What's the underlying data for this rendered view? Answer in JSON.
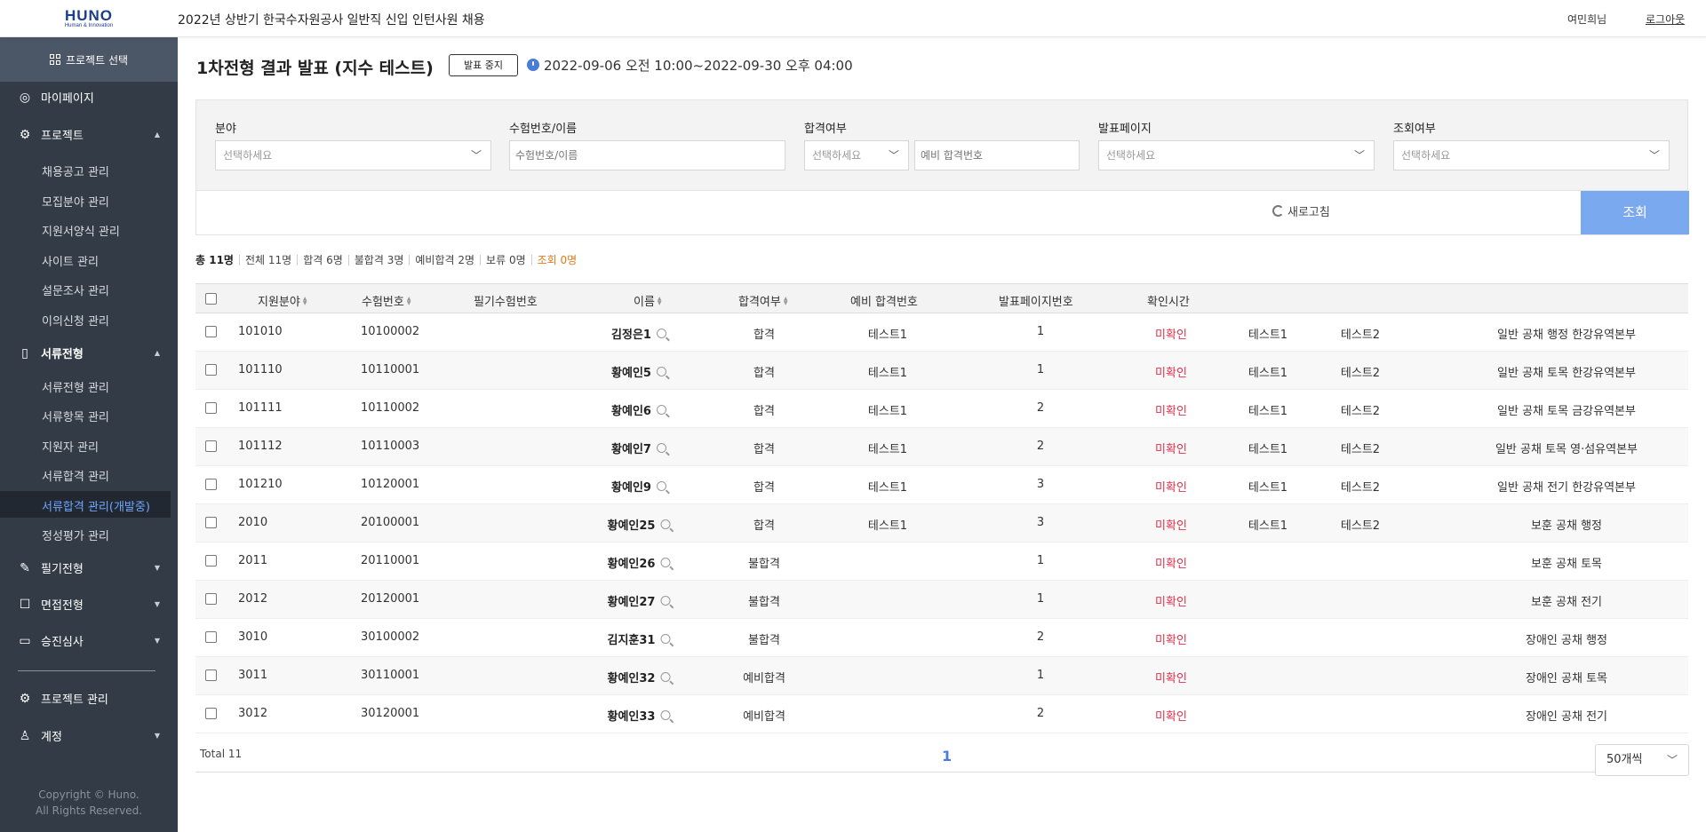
{
  "header": {
    "logo_main": "HUNO",
    "logo_sub": "Human & Innovation",
    "title": "2022년 상반기 한국수자원공사 일반직 신입 인턴사원 채용",
    "user": "여민희님",
    "logout": "로그아웃"
  },
  "sidebar": {
    "project_select": "프로젝트 선택",
    "mypage": "마이페이지",
    "project": "프로젝트",
    "project_items": [
      "채용공고 관리",
      "모집분야 관리",
      "지원서양식 관리",
      "사이트 관리",
      "설문조사 관리",
      "이의신청 관리"
    ],
    "document": "서류전형",
    "document_items": [
      "서류전형 관리",
      "서류항목 관리",
      "지원자 관리",
      "서류합격 관리",
      "서류합격 관리(개발중)",
      "정성평가 관리"
    ],
    "written": "필기전형",
    "interview": "면접전형",
    "promotion": "승진심사",
    "project_manage": "프로젝트 관리",
    "account": "계정",
    "copyright_1": "Copyright © Huno.",
    "copyright_2": "All Rights Reserved."
  },
  "page": {
    "title": "1차전형 결과 발표 (지수 테스트)",
    "status_button": "발표 중지",
    "period": "2022-09-06 오전 10:00~2022-09-30 오후 04:00"
  },
  "filters": {
    "field_label": "분야",
    "field_placeholder": "선택하세요",
    "exam_label": "수험번호/이름",
    "exam_placeholder": "수험번호/이름",
    "pass_label": "합격여부",
    "pass_placeholder": "선택하세요",
    "reserve_placeholder": "예비 합격번호",
    "page_label": "발표페이지",
    "page_placeholder": "선택하세요",
    "view_label": "조회여부",
    "view_placeholder": "선택하세요",
    "refresh": "새로고침",
    "search": "조회"
  },
  "stats": {
    "total": "총 11명",
    "all": "전체 11명",
    "pass": "합격 6명",
    "fail": "불합격 3명",
    "reserve": "예비합격 2명",
    "hold": "보류 0명",
    "views": "조회 0명"
  },
  "table": {
    "headers": {
      "field": "지원분야",
      "exam_no": "수험번호",
      "written_no": "필기수험번호",
      "name": "이름",
      "result": "합격여부",
      "reserve_no": "예비 합격번호",
      "page_no": "발표페이지번호",
      "confirm_time": "확인시간"
    },
    "rows": [
      {
        "field": "101010",
        "exam_no": "10100002",
        "name": "김정은1",
        "result": "합격",
        "reserve": "테스트1",
        "page": "1",
        "confirm": "미확인",
        "t1": "테스트1",
        "t2": "테스트2",
        "dept": "일반 공채 행정 한강유역본부"
      },
      {
        "field": "101110",
        "exam_no": "10110001",
        "name": "황예인5",
        "result": "합격",
        "reserve": "테스트1",
        "page": "1",
        "confirm": "미확인",
        "t1": "테스트1",
        "t2": "테스트2",
        "dept": "일반 공채 토목 한강유역본부"
      },
      {
        "field": "101111",
        "exam_no": "10110002",
        "name": "황예인6",
        "result": "합격",
        "reserve": "테스트1",
        "page": "2",
        "confirm": "미확인",
        "t1": "테스트1",
        "t2": "테스트2",
        "dept": "일반 공채 토목 금강유역본부"
      },
      {
        "field": "101112",
        "exam_no": "10110003",
        "name": "황예인7",
        "result": "합격",
        "reserve": "테스트1",
        "page": "2",
        "confirm": "미확인",
        "t1": "테스트1",
        "t2": "테스트2",
        "dept": "일반 공채 토목 영·섬유역본부"
      },
      {
        "field": "101210",
        "exam_no": "10120001",
        "name": "황예인9",
        "result": "합격",
        "reserve": "테스트1",
        "page": "3",
        "confirm": "미확인",
        "t1": "테스트1",
        "t2": "테스트2",
        "dept": "일반 공채 전기 한강유역본부"
      },
      {
        "field": "2010",
        "exam_no": "20100001",
        "name": "황예인25",
        "result": "합격",
        "reserve": "테스트1",
        "page": "3",
        "confirm": "미확인",
        "t1": "테스트1",
        "t2": "테스트2",
        "dept": "보훈 공채 행정"
      },
      {
        "field": "2011",
        "exam_no": "20110001",
        "name": "황예인26",
        "result": "불합격",
        "reserve": "",
        "page": "1",
        "confirm": "미확인",
        "t1": "",
        "t2": "",
        "dept": "보훈 공채 토목"
      },
      {
        "field": "2012",
        "exam_no": "20120001",
        "name": "황예인27",
        "result": "불합격",
        "reserve": "",
        "page": "1",
        "confirm": "미확인",
        "t1": "",
        "t2": "",
        "dept": "보훈 공채 전기"
      },
      {
        "field": "3010",
        "exam_no": "30100002",
        "name": "김지훈31",
        "result": "불합격",
        "reserve": "",
        "page": "2",
        "confirm": "미확인",
        "t1": "",
        "t2": "",
        "dept": "장애인 공채 행정"
      },
      {
        "field": "3011",
        "exam_no": "30110001",
        "name": "황예인32",
        "result": "예비합격",
        "reserve": "",
        "page": "1",
        "confirm": "미확인",
        "t1": "",
        "t2": "",
        "dept": "장애인 공채 토목"
      },
      {
        "field": "3012",
        "exam_no": "30120001",
        "name": "황예인33",
        "result": "예비합격",
        "reserve": "",
        "page": "2",
        "confirm": "미확인",
        "t1": "",
        "t2": "",
        "dept": "장애인 공채 전기"
      }
    ]
  },
  "pagination": {
    "total": "Total 11",
    "current": "1",
    "page_size": "50개씩"
  }
}
